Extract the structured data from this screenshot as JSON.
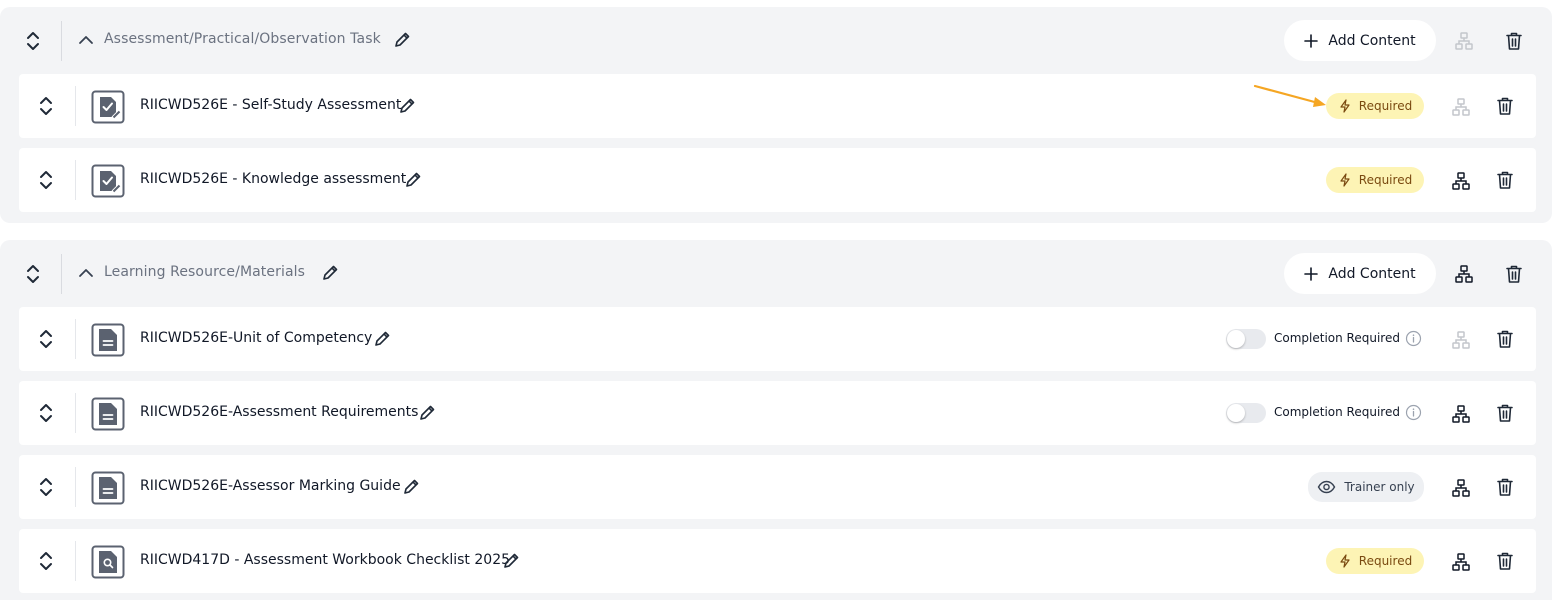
{
  "sections": [
    {
      "title": "Assessment/Practical/Observation Task",
      "add_button_label": "Add Content",
      "rows": [
        {
          "title": "RIICWD526E - Self-Study Assessment",
          "icon": "assessment-file-icon",
          "status": "required",
          "badge_label": "Required",
          "tree_disabled": true
        },
        {
          "title": "RIICWD526E - Knowledge assessment",
          "icon": "assessment-file-icon",
          "status": "required",
          "badge_label": "Required",
          "tree_disabled": false
        }
      ]
    },
    {
      "title": "Learning Resource/Materials",
      "add_button_label": "Add Content",
      "rows": [
        {
          "title": "RIICWD526E-Unit of Competency",
          "icon": "document-file-icon",
          "status": "completion-toggle",
          "completion_label": "Completion Required",
          "completion_on": false,
          "tree_disabled": true
        },
        {
          "title": "RIICWD526E-Assessment Requirements",
          "icon": "document-file-icon",
          "status": "completion-toggle",
          "completion_label": "Completion Required",
          "completion_on": false,
          "tree_disabled": false
        },
        {
          "title": "RIICWD526E-Assessor Marking Guide",
          "icon": "document-file-icon",
          "status": "trainer-only",
          "badge_label": "Trainer only",
          "tree_disabled": false
        },
        {
          "title": "RIICWD417D - Assessment Workbook Checklist 2025",
          "icon": "search-file-icon",
          "status": "required",
          "badge_label": "Required",
          "tree_disabled": false
        }
      ]
    }
  ],
  "colors": {
    "required_badge_bg": "#fdf4b5",
    "required_badge_text": "#7a4a10",
    "annotation_arrow": "#f5a623",
    "section_bg": "#f3f4f6"
  }
}
